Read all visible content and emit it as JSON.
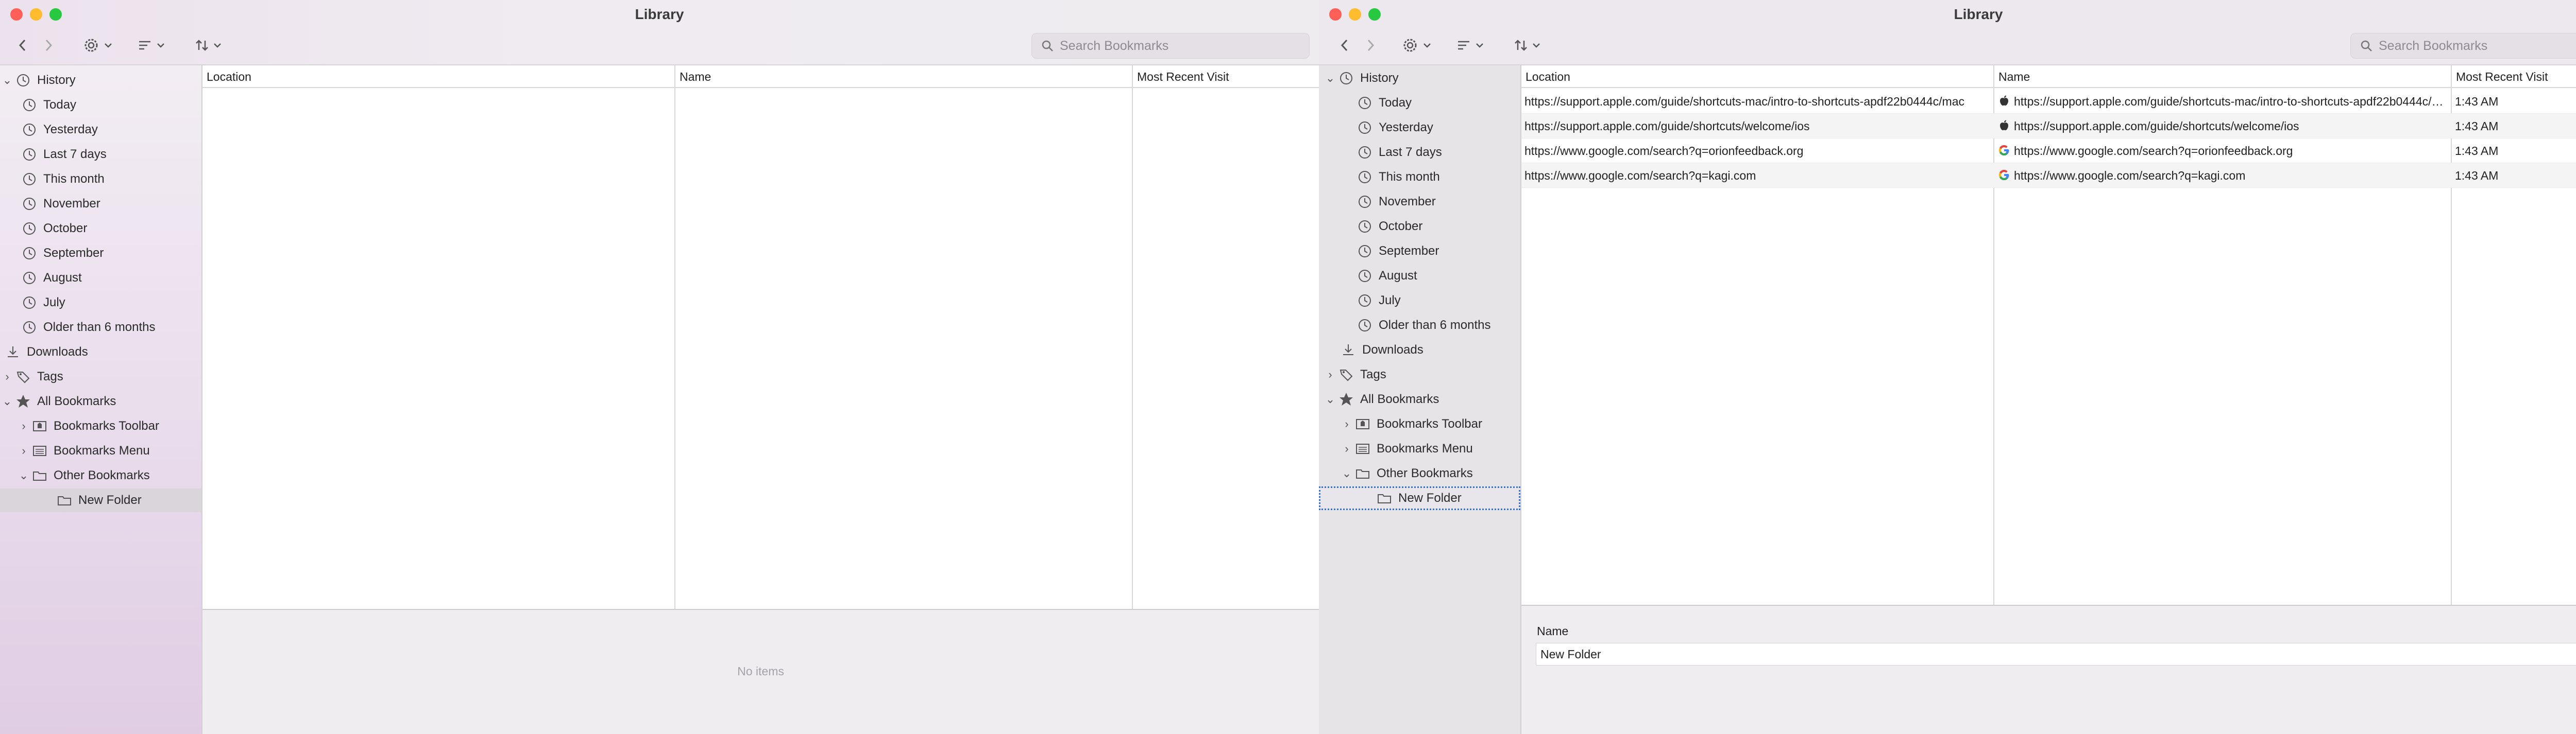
{
  "left_window": {
    "title": "Library",
    "search_placeholder": "Search Bookmarks",
    "columns": [
      "Location",
      "Name",
      "Most Recent Visit"
    ],
    "empty_text": "No items",
    "selected": "New Folder"
  },
  "right_window": {
    "title": "Library",
    "search_placeholder": "Search Bookmarks",
    "columns": [
      "Location",
      "Name",
      "Most Recent Visit"
    ],
    "rows": [
      {
        "location": "https://support.apple.com/guide/shortcuts-mac/intro-to-shortcuts-apdf22b0444c/mac",
        "name": "https://support.apple.com/guide/shortcuts-mac/intro-to-shortcuts-apdf22b0444c/mac",
        "visit": "1:43 AM",
        "favicon": "apple-icon"
      },
      {
        "location": "https://support.apple.com/guide/shortcuts/welcome/ios",
        "name": "https://support.apple.com/guide/shortcuts/welcome/ios",
        "visit": "1:43 AM",
        "favicon": "apple-icon"
      },
      {
        "location": "https://www.google.com/search?q=orionfeedback.org",
        "name": "https://www.google.com/search?q=orionfeedback.org",
        "visit": "1:43 AM",
        "favicon": "google-icon"
      },
      {
        "location": "https://www.google.com/search?q=kagi.com",
        "name": "https://www.google.com/search?q=kagi.com",
        "visit": "1:43 AM",
        "favicon": "google-icon"
      }
    ],
    "detail_label": "Name",
    "detail_value": "New Folder",
    "selected": "New Folder"
  },
  "sidebar": {
    "history": "History",
    "history_items": [
      "Today",
      "Yesterday",
      "Last 7 days",
      "This month",
      "November",
      "October",
      "September",
      "August",
      "July",
      "Older than 6 months"
    ],
    "downloads": "Downloads",
    "tags": "Tags",
    "all_bookmarks": "All Bookmarks",
    "bookmarks_toolbar": "Bookmarks Toolbar",
    "bookmarks_menu": "Bookmarks Menu",
    "other_bookmarks": "Other Bookmarks",
    "new_folder": "New Folder"
  },
  "colors": {
    "close": "#fe5f57",
    "minimize": "#febc2e",
    "maximize": "#28c840",
    "selection_outline": "#2f6fd6"
  }
}
